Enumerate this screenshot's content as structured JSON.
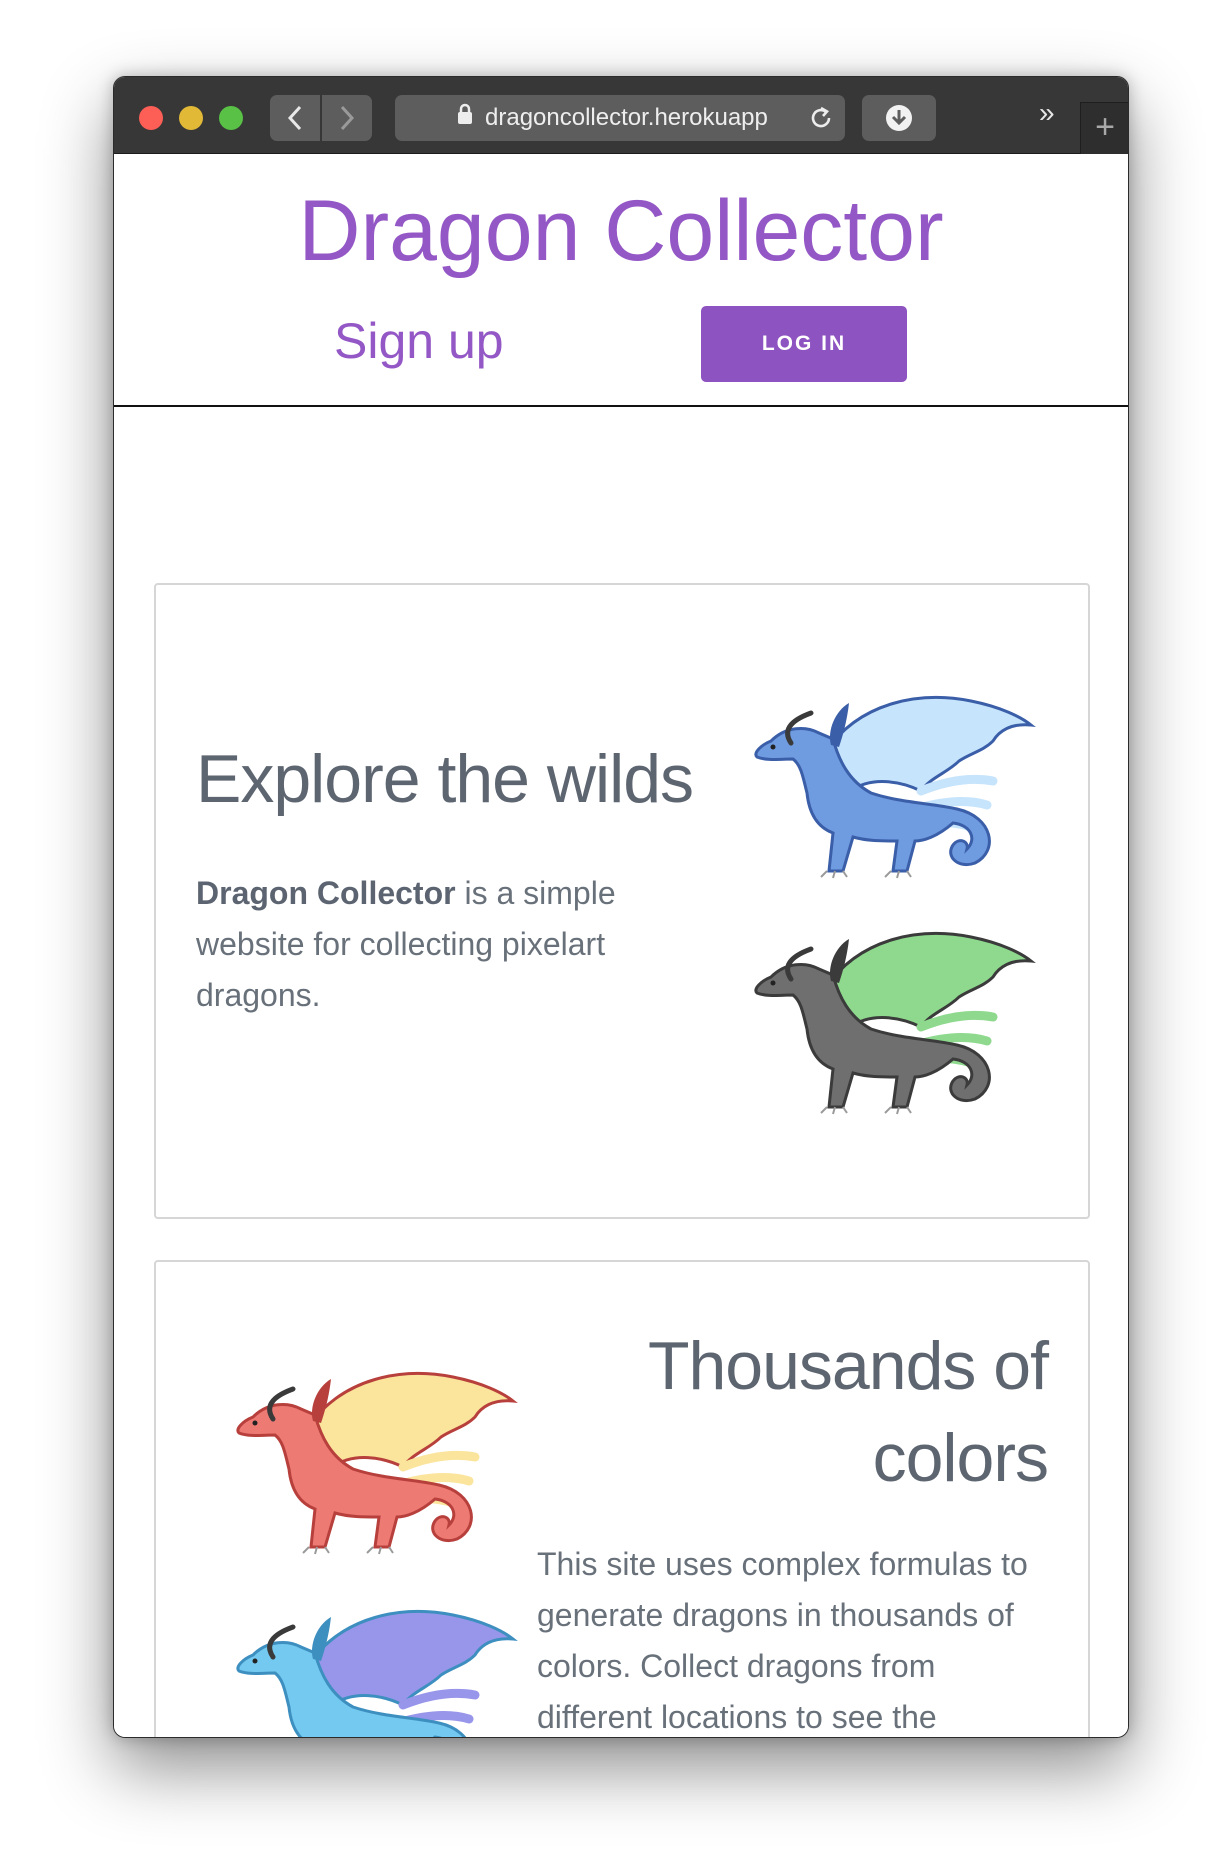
{
  "browser": {
    "url": "dragoncollector.herokuapp",
    "icons": {
      "back": "chevron-left-icon",
      "forward": "chevron-right-icon",
      "lock": "lock-icon",
      "reload": "reload-icon",
      "download": "download-icon",
      "overflow": "double-chevron-icon",
      "new_tab": "plus-icon"
    }
  },
  "header": {
    "title": "Dragon Collector",
    "signup_label": "Sign up",
    "login_label": "LOG IN",
    "accent_color": "#9457c6"
  },
  "section1": {
    "heading": "Explore the wilds",
    "brand": "Dragon Collector",
    "text": " is a simple website for collecting pixelart dragons.",
    "dragons": [
      {
        "body": "#6f9be0",
        "wing": "#c6e4fb",
        "dark": "#3a5ea8"
      },
      {
        "body": "#6f6f6f",
        "wing": "#8ed98e",
        "dark": "#3b3b3b"
      }
    ]
  },
  "section2": {
    "heading_line1": "Thousands of",
    "heading_line2": "colors",
    "text": "This site uses complex formulas to generate dragons in thousands of colors. Collect dragons from different locations to see the possibilities.",
    "dragons": [
      {
        "body": "#ee7a74",
        "wing": "#fbe49b",
        "dark": "#b8403c"
      },
      {
        "body": "#73c9ef",
        "wing": "#9896ea",
        "dark": "#3d8fc0"
      }
    ]
  }
}
